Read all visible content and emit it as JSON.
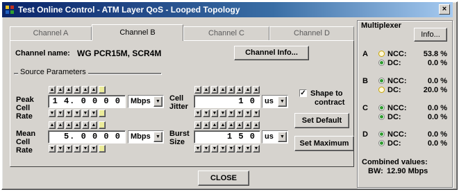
{
  "window": {
    "title": "Test Online Control - ATM Layer QoS - Looped Topology",
    "close_glyph": "×"
  },
  "tabs": [
    {
      "label": "Channel A",
      "active": false
    },
    {
      "label": "Channel B",
      "active": true
    },
    {
      "label": "Channel C",
      "active": false
    },
    {
      "label": "Channel D",
      "active": false
    }
  ],
  "channel": {
    "name_label": "Channel name:",
    "name_value": "WG PCR15M, SCR4M",
    "info_button": "Channel Info..."
  },
  "source_params": {
    "group_label": "Source Parameters",
    "peak": {
      "label_lines": [
        "Peak",
        "Cell",
        "Rate"
      ],
      "value": "1 4. 0 0 0 0",
      "unit": "Mbps"
    },
    "mean": {
      "label_lines": [
        "Mean",
        "Cell",
        "Rate"
      ],
      "value": "5. 0 0 0 0",
      "unit": "Mbps"
    },
    "jitter": {
      "label_lines": [
        "Cell",
        "Jitter"
      ],
      "value": "1 0",
      "unit": "us"
    },
    "burst": {
      "label_lines": [
        "Burst",
        "Size"
      ],
      "value": "1 5 0",
      "unit": "us"
    },
    "up_glyph": "▲",
    "down_glyph": "▼",
    "combo_arrow": "▼"
  },
  "shape": {
    "checked": true,
    "check_glyph": "✓",
    "label_line1": "Shape to",
    "label_line2": "contract"
  },
  "buttons": {
    "set_default": "Set Default",
    "set_maximum": "Set Maximum",
    "close": "CLOSE"
  },
  "multiplexer": {
    "title": "Multiplexer",
    "info_button": "Info...",
    "channels": [
      {
        "letter": "A",
        "ncc_label": "NCC:",
        "ncc_value": "53.8 %",
        "dc_label": "DC:",
        "dc_value": "0.0 %",
        "ncc_selected": false,
        "dc_selected": true
      },
      {
        "letter": "B",
        "ncc_label": "NCC:",
        "ncc_value": "0.0 %",
        "dc_label": "DC:",
        "dc_value": "20.0 %",
        "ncc_selected": true,
        "dc_selected": false
      },
      {
        "letter": "C",
        "ncc_label": "NCC:",
        "ncc_value": "0.0 %",
        "dc_label": "DC:",
        "dc_value": "0.0 %",
        "ncc_selected": true,
        "dc_selected": true
      },
      {
        "letter": "D",
        "ncc_label": "NCC:",
        "ncc_value": "0.0 %",
        "dc_label": "DC:",
        "dc_value": "0.0 %",
        "ncc_selected": true,
        "dc_selected": true
      }
    ],
    "combined_label": "Combined values:",
    "bw_label": "BW:",
    "bw_value": "12.90 Mbps"
  },
  "colors": {
    "title_bar_start": "#0a246a",
    "title_bar_end": "#a6caf0",
    "radio_selected": "#2e9a2e",
    "radio_unselected": "#c9a600",
    "spin_highlight": "#ecec9a"
  },
  "icons": {
    "app": "app-icon",
    "close": "close-icon",
    "spin_up": "spin-up-icon",
    "spin_down": "spin-down-icon",
    "dropdown": "chevron-down-icon"
  }
}
